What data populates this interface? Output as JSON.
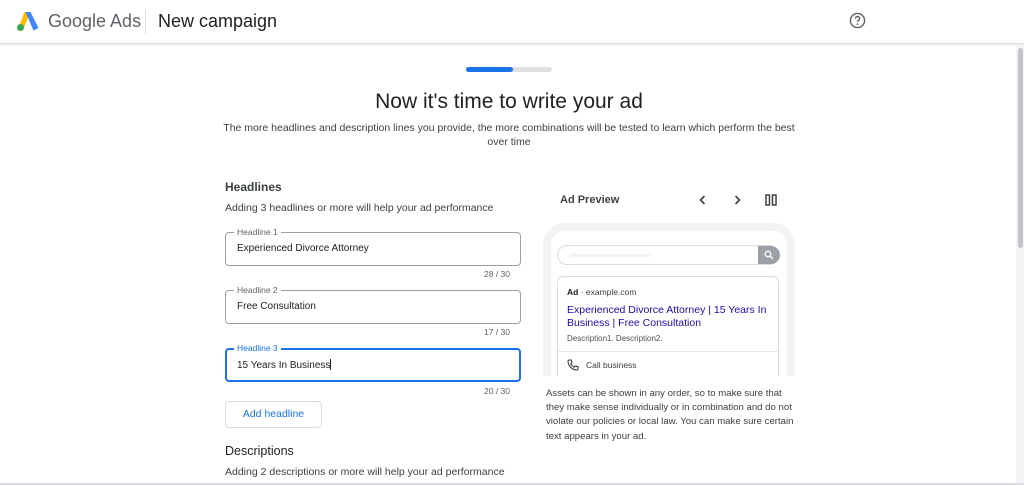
{
  "header": {
    "brand": "Google Ads",
    "page": "New campaign",
    "help_icon": "help-circle-icon",
    "logo_icon": "google-ads-logo"
  },
  "progress": {
    "fraction": 0.55
  },
  "main": {
    "title": "Now it's time to write your ad",
    "subtitle": "The more headlines and description lines you provide, the more combinations will be tested to learn which perform the best over time"
  },
  "headlines": {
    "heading": "Headlines",
    "hint": "Adding 3 headlines or more will help your ad performance",
    "fields": [
      {
        "label": "Headline 1",
        "value": "Experienced Divorce Attorney",
        "counter": "28 / 30"
      },
      {
        "label": "Headline 2",
        "value": "Free Consultation",
        "counter": "17 / 30"
      },
      {
        "label": "Headline 3",
        "value": "15 Years In Business",
        "counter": "20 / 30"
      }
    ],
    "add_button": "Add headline"
  },
  "descriptions": {
    "heading": "Descriptions",
    "hint": "Adding 2 descriptions or more will help your ad performance"
  },
  "preview": {
    "title": "Ad Preview",
    "ad_badge": "Ad",
    "ad_domain": " · example.com",
    "ad_headline": "Experienced Divorce Attorney | 15 Years In Business | Free Consultation",
    "ad_description": "Description1. Description2.",
    "call_label": "Call business",
    "disclaimer": "Assets can be shown in any order, so to make sure that they make sense individually or in combination and do not violate our policies or local law. You can make sure certain text appears in your ad."
  },
  "colors": {
    "accent": "#1a73e8",
    "ad_link": "#1a0dab",
    "border": "#dadce0"
  }
}
